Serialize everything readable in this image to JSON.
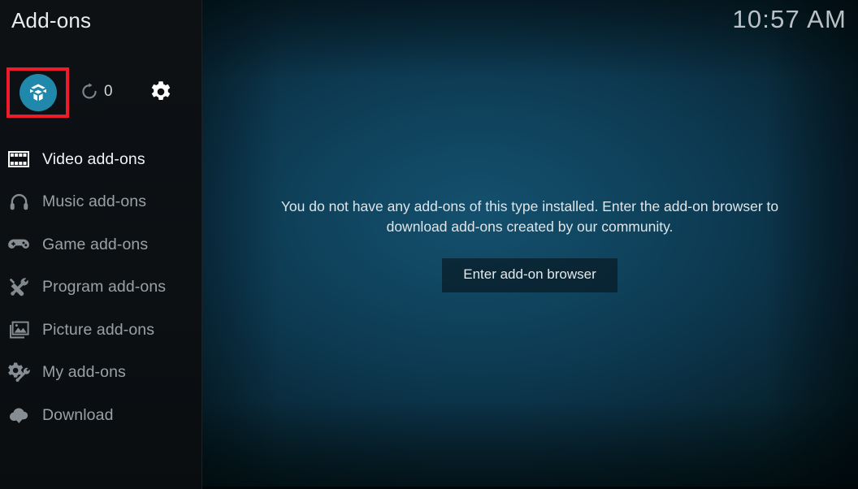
{
  "window": {
    "title": "Add-ons",
    "clock": "10:57 AM"
  },
  "toolbar": {
    "addon_button_icon": "open-box-icon",
    "addon_button_color": "#2089ab",
    "highlight_color": "#ee1c2a",
    "refresh_icon": "refresh-icon",
    "update_count": "0",
    "settings_icon": "gear-icon"
  },
  "sidebar": {
    "items": [
      {
        "label": "Video add-ons",
        "icon": "film-strip-icon",
        "selected": true
      },
      {
        "label": "Music add-ons",
        "icon": "headphones-icon",
        "selected": false
      },
      {
        "label": "Game add-ons",
        "icon": "gamepad-icon",
        "selected": false
      },
      {
        "label": "Program add-ons",
        "icon": "screwdriver-wrench-icon",
        "selected": false
      },
      {
        "label": "Picture add-ons",
        "icon": "picture-frame-icon",
        "selected": false
      },
      {
        "label": "My add-ons",
        "icon": "gear-wrench-icon",
        "selected": false
      },
      {
        "label": "Download",
        "icon": "cloud-download-icon",
        "selected": false
      }
    ]
  },
  "main": {
    "empty_message": "You do not have any add-ons of this type installed. Enter the add-on browser to download add-ons created by our community.",
    "enter_browser_label": "Enter add-on browser"
  }
}
